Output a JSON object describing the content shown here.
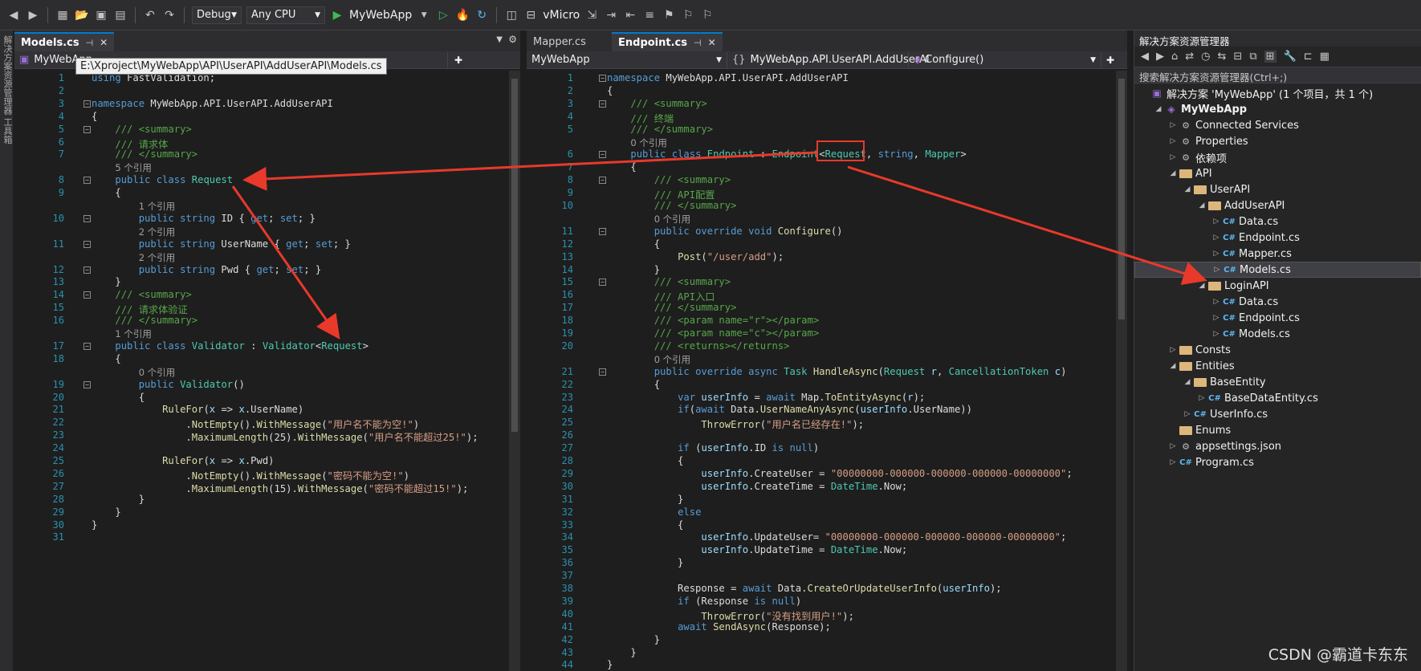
{
  "toolbar": {
    "config": "Debug",
    "platform": "Any CPU",
    "run_target": "MyWebApp",
    "vmicro": "vMicro"
  },
  "left_pane": {
    "tab_label": "Models.cs",
    "nav_project": "MyWebApp",
    "tooltip": "E:\\Xproject\\MyWebApp\\API\\UserAPI\\AddUserAPI\\Models.cs",
    "lines": [
      {
        "n": "1",
        "html": "<span class='kw'>using</span> FastValidation;"
      },
      {
        "n": "2",
        "html": ""
      },
      {
        "n": "3",
        "html": "<span class='kw'>namespace</span> MyWebApp.API.UserAPI.AddUserAPI"
      },
      {
        "n": "4",
        "html": "{"
      },
      {
        "n": "5",
        "html": "    <span class='cm'>/// &lt;summary&gt;</span>"
      },
      {
        "n": "6",
        "html": "    <span class='cm'>/// 请求体</span>"
      },
      {
        "n": "7",
        "html": "    <span class='cm'>/// &lt;/summary&gt;</span>"
      },
      {
        "n": "",
        "html": "    <span class='ref'>5 个引用</span>"
      },
      {
        "n": "8",
        "html": "    <span class='kw'>public class</span> <span class='ty'>Request</span>"
      },
      {
        "n": "9",
        "html": "    {"
      },
      {
        "n": "",
        "html": "        <span class='ref'>1 个引用</span>"
      },
      {
        "n": "10",
        "html": "        <span class='kw'>public string</span> ID { <span class='kw'>get</span>; <span class='kw'>set</span>; }"
      },
      {
        "n": "",
        "html": "        <span class='ref'>2 个引用</span>"
      },
      {
        "n": "11",
        "html": "        <span class='kw'>public string</span> UserName { <span class='kw'>get</span>; <span class='kw'>set</span>; }"
      },
      {
        "n": "",
        "html": "        <span class='ref'>2 个引用</span>"
      },
      {
        "n": "12",
        "html": "        <span class='kw'>public string</span> Pwd { <span class='kw'>get</span>; <span class='kw'>set</span>; }"
      },
      {
        "n": "13",
        "html": "    }"
      },
      {
        "n": "14",
        "html": "    <span class='cm'>/// &lt;summary&gt;</span>"
      },
      {
        "n": "15",
        "html": "    <span class='cm'>/// 请求体验证</span>"
      },
      {
        "n": "16",
        "html": "    <span class='cm'>/// &lt;/summary&gt;</span>"
      },
      {
        "n": "",
        "html": "    <span class='ref'>1 个引用</span>"
      },
      {
        "n": "17",
        "html": "    <span class='kw'>public class</span> <span class='ty'>Validator</span> : <span class='ty'>Validator</span>&lt;<span class='ty'>Request</span>&gt;"
      },
      {
        "n": "18",
        "html": "    {"
      },
      {
        "n": "",
        "html": "        <span class='ref'>0 个引用</span>"
      },
      {
        "n": "19",
        "html": "        <span class='kw'>public</span> <span class='ty'>Validator</span>()"
      },
      {
        "n": "20",
        "html": "        {"
      },
      {
        "n": "21",
        "html": "            <span class='me'>RuleFor</span>(<span class='va'>x</span> =&gt; <span class='va'>x</span>.UserName)"
      },
      {
        "n": "22",
        "html": "                .<span class='me'>NotEmpty</span>().<span class='me'>WithMessage</span>(<span class='st'>\"用户名不能为空!\"</span>)"
      },
      {
        "n": "23",
        "html": "                .<span class='me'>MaximumLength</span>(25).<span class='me'>WithMessage</span>(<span class='st'>\"用户名不能超过25!\"</span>);"
      },
      {
        "n": "24",
        "html": ""
      },
      {
        "n": "25",
        "html": "            <span class='me'>RuleFor</span>(<span class='va'>x</span> =&gt; <span class='va'>x</span>.Pwd)"
      },
      {
        "n": "26",
        "html": "                .<span class='me'>NotEmpty</span>().<span class='me'>WithMessage</span>(<span class='st'>\"密码不能为空!\"</span>)"
      },
      {
        "n": "27",
        "html": "                .<span class='me'>MaximumLength</span>(15).<span class='me'>WithMessage</span>(<span class='st'>\"密码不能超过15!\"</span>);"
      },
      {
        "n": "28",
        "html": "        }"
      },
      {
        "n": "29",
        "html": "    }"
      },
      {
        "n": "30",
        "html": "}"
      },
      {
        "n": "31",
        "html": ""
      }
    ]
  },
  "mid_pane": {
    "tab_inactive": "Mapper.cs",
    "tab_active": "Endpoint.cs",
    "nav_project": "MyWebApp",
    "nav_namespace": "MyWebApp.API.UserAPI.AddUserAl",
    "nav_member": "Configure()",
    "lines": [
      {
        "n": "1",
        "html": "<span class='kw'>namespace</span> MyWebApp.API.UserAPI.AddUserAPI"
      },
      {
        "n": "2",
        "html": "{"
      },
      {
        "n": "3",
        "html": "    <span class='cm'>/// &lt;summary&gt;</span>"
      },
      {
        "n": "4",
        "html": "    <span class='cm'>/// 终端</span>"
      },
      {
        "n": "5",
        "html": "    <span class='cm'>/// &lt;/summary&gt;</span>"
      },
      {
        "n": "",
        "html": "    <span class='ref'>0 个引用</span>"
      },
      {
        "n": "6",
        "html": "    <span class='kw'>public class</span> <span class='ty'>Endpoint</span> : <span class='ty'>Endpoint</span>&lt;<span class='ty'>Request</span>, <span class='kw'>string</span>, <span class='ty'>Mapper</span>&gt;"
      },
      {
        "n": "7",
        "html": "    {"
      },
      {
        "n": "8",
        "html": "        <span class='cm'>/// &lt;summary&gt;</span>"
      },
      {
        "n": "9",
        "html": "        <span class='cm'>/// API配置</span>"
      },
      {
        "n": "10",
        "html": "        <span class='cm'>/// &lt;/summary&gt;</span>"
      },
      {
        "n": "",
        "html": "        <span class='ref'>0 个引用</span>"
      },
      {
        "n": "11",
        "html": "        <span class='kw'>public override void</span> <span class='me'>Configure</span>()"
      },
      {
        "n": "12",
        "html": "        {"
      },
      {
        "n": "13",
        "html": "            <span class='me'>Post</span>(<span class='st'>\"/user/add\"</span>);"
      },
      {
        "n": "14",
        "html": "        }"
      },
      {
        "n": "15",
        "html": "        <span class='cm'>/// &lt;summary&gt;</span>"
      },
      {
        "n": "16",
        "html": "        <span class='cm'>/// API入口</span>"
      },
      {
        "n": "17",
        "html": "        <span class='cm'>/// &lt;/summary&gt;</span>"
      },
      {
        "n": "18",
        "html": "        <span class='cm'>/// &lt;param name=\"r\"&gt;&lt;/param&gt;</span>"
      },
      {
        "n": "19",
        "html": "        <span class='cm'>/// &lt;param name=\"c\"&gt;&lt;/param&gt;</span>"
      },
      {
        "n": "20",
        "html": "        <span class='cm'>/// &lt;returns&gt;&lt;/returns&gt;</span>"
      },
      {
        "n": "",
        "html": "        <span class='ref'>0 个引用</span>"
      },
      {
        "n": "21",
        "html": "        <span class='kw'>public override async</span> <span class='ty'>Task</span> <span class='me'>HandleAsync</span>(<span class='ty'>Request</span> <span class='va'>r</span>, <span class='ty'>CancellationToken</span> <span class='va'>c</span>)"
      },
      {
        "n": "22",
        "html": "        {"
      },
      {
        "n": "23",
        "html": "            <span class='kw'>var</span> <span class='va'>userInfo</span> = <span class='kw'>await</span> Map.<span class='me'>ToEntityAsync</span>(<span class='va'>r</span>);"
      },
      {
        "n": "24",
        "html": "            <span class='kw'>if</span>(<span class='kw'>await</span> Data.<span class='me'>UserNameAnyAsync</span>(<span class='va'>userInfo</span>.UserName))"
      },
      {
        "n": "25",
        "html": "                <span class='me'>ThrowError</span>(<span class='st'>\"用户名已经存在!\"</span>);"
      },
      {
        "n": "26",
        "html": ""
      },
      {
        "n": "27",
        "html": "            <span class='kw'>if</span> (<span class='va'>userInfo</span>.ID <span class='kw'>is null</span>)"
      },
      {
        "n": "28",
        "html": "            {"
      },
      {
        "n": "29",
        "html": "                <span class='va'>userInfo</span>.CreateUser = <span class='st'>\"00000000-000000-000000-000000-00000000\"</span>;"
      },
      {
        "n": "30",
        "html": "                <span class='va'>userInfo</span>.CreateTime = <span class='ty'>DateTime</span>.Now;"
      },
      {
        "n": "31",
        "html": "            }"
      },
      {
        "n": "32",
        "html": "            <span class='kw'>else</span>"
      },
      {
        "n": "33",
        "html": "            {"
      },
      {
        "n": "34",
        "html": "                <span class='va'>userInfo</span>.UpdateUser= <span class='st'>\"00000000-000000-000000-000000-00000000\"</span>;"
      },
      {
        "n": "35",
        "html": "                <span class='va'>userInfo</span>.UpdateTime = <span class='ty'>DateTime</span>.Now;"
      },
      {
        "n": "36",
        "html": "            }"
      },
      {
        "n": "37",
        "html": ""
      },
      {
        "n": "38",
        "html": "            Response = <span class='kw'>await</span> Data.<span class='me'>CreateOrUpdateUserInfo</span>(<span class='va'>userInfo</span>);"
      },
      {
        "n": "39",
        "html": "            <span class='kw'>if</span> (Response <span class='kw'>is null</span>)"
      },
      {
        "n": "40",
        "html": "                <span class='me'>ThrowError</span>(<span class='st'>\"没有找到用户!\"</span>);"
      },
      {
        "n": "41",
        "html": "            <span class='kw'>await</span> <span class='me'>SendAsync</span>(Response);"
      },
      {
        "n": "42",
        "html": "        }"
      },
      {
        "n": "43",
        "html": "    }"
      },
      {
        "n": "44",
        "html": "}"
      }
    ]
  },
  "solution_explorer": {
    "title": "解决方案资源管理器",
    "search": "搜索解决方案资源管理器(Ctrl+;)",
    "items": [
      {
        "label": "解决方案 'MyWebApp' (1 个项目，共 1 个)",
        "indent": 0,
        "icon": "solution",
        "tw": ""
      },
      {
        "label": "MyWebApp",
        "indent": 1,
        "icon": "project",
        "tw": "◢",
        "bold": true
      },
      {
        "label": "Connected Services",
        "indent": 2,
        "icon": "gen",
        "tw": "▷"
      },
      {
        "label": "Properties",
        "indent": 2,
        "icon": "gen",
        "tw": "▷"
      },
      {
        "label": "依赖项",
        "indent": 2,
        "icon": "gen",
        "tw": "▷"
      },
      {
        "label": "API",
        "indent": 2,
        "icon": "folder",
        "tw": "◢"
      },
      {
        "label": "UserAPI",
        "indent": 3,
        "icon": "folder",
        "tw": "◢"
      },
      {
        "label": "AddUserAPI",
        "indent": 4,
        "icon": "folder",
        "tw": "◢"
      },
      {
        "label": "Data.cs",
        "indent": 5,
        "icon": "cs",
        "tw": "▷"
      },
      {
        "label": "Endpoint.cs",
        "indent": 5,
        "icon": "cs",
        "tw": "▷"
      },
      {
        "label": "Mapper.cs",
        "indent": 5,
        "icon": "cs",
        "tw": "▷"
      },
      {
        "label": "Models.cs",
        "indent": 5,
        "icon": "cs",
        "tw": "▷",
        "selected": true
      },
      {
        "label": "LoginAPI",
        "indent": 4,
        "icon": "folder",
        "tw": "◢"
      },
      {
        "label": "Data.cs",
        "indent": 5,
        "icon": "cs",
        "tw": "▷"
      },
      {
        "label": "Endpoint.cs",
        "indent": 5,
        "icon": "cs",
        "tw": "▷"
      },
      {
        "label": "Models.cs",
        "indent": 5,
        "icon": "cs",
        "tw": "▷"
      },
      {
        "label": "Consts",
        "indent": 2,
        "icon": "folder",
        "tw": "▷"
      },
      {
        "label": "Entities",
        "indent": 2,
        "icon": "folder",
        "tw": "◢"
      },
      {
        "label": "BaseEntity",
        "indent": 3,
        "icon": "folder",
        "tw": "◢"
      },
      {
        "label": "BaseDataEntity.cs",
        "indent": 4,
        "icon": "cs",
        "tw": "▷"
      },
      {
        "label": "UserInfo.cs",
        "indent": 3,
        "icon": "cs",
        "tw": "▷"
      },
      {
        "label": "Enums",
        "indent": 2,
        "icon": "folder",
        "tw": ""
      },
      {
        "label": "appsettings.json",
        "indent": 2,
        "icon": "gen",
        "tw": "▷"
      },
      {
        "label": "Program.cs",
        "indent": 2,
        "icon": "cs",
        "tw": "▷"
      }
    ]
  },
  "watermark": "CSDN @霸道卡东东",
  "vstrip": "解决方案资源管理器  工具箱"
}
